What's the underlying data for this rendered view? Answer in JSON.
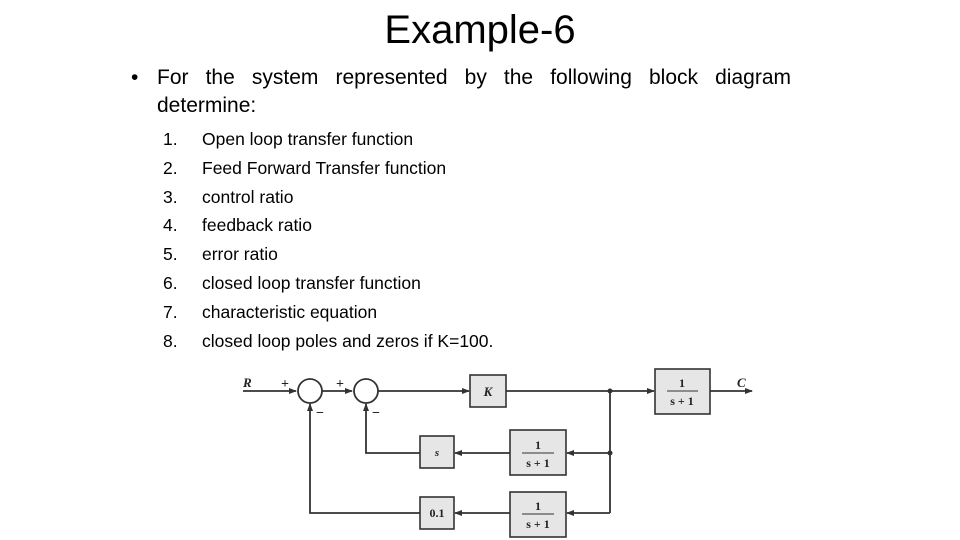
{
  "slide": {
    "title": "Example-6",
    "bullet_symbol": "•",
    "bullet_text": "For the system represented by the following block diagram determine:",
    "items": [
      {
        "num": "1.",
        "text": "Open loop transfer function"
      },
      {
        "num": "2.",
        "text": "Feed Forward Transfer function"
      },
      {
        "num": "3.",
        "text": "control ratio"
      },
      {
        "num": "4.",
        "text": "feedback ratio"
      },
      {
        "num": "5.",
        "text": "error ratio"
      },
      {
        "num": "6.",
        "text": "closed loop transfer function"
      },
      {
        "num": "7.",
        "text": "characteristic equation"
      },
      {
        "num": "8.",
        "text": "closed loop poles and zeros if K=100."
      }
    ]
  },
  "diagram": {
    "input_label": "R",
    "output_label": "C",
    "sum1_signs": {
      "input": "+",
      "feedback": "−"
    },
    "sum2_signs": {
      "input": "+",
      "feedback": "−"
    },
    "forward_gain": "K",
    "plant": {
      "num": "1",
      "den": "s + 1"
    },
    "inner_feedback": {
      "filter": {
        "num": "1",
        "den": "s + 1"
      },
      "gain": "s"
    },
    "outer_feedback": {
      "filter": {
        "num": "1",
        "den": "s + 1"
      },
      "gain": "0.1"
    }
  }
}
